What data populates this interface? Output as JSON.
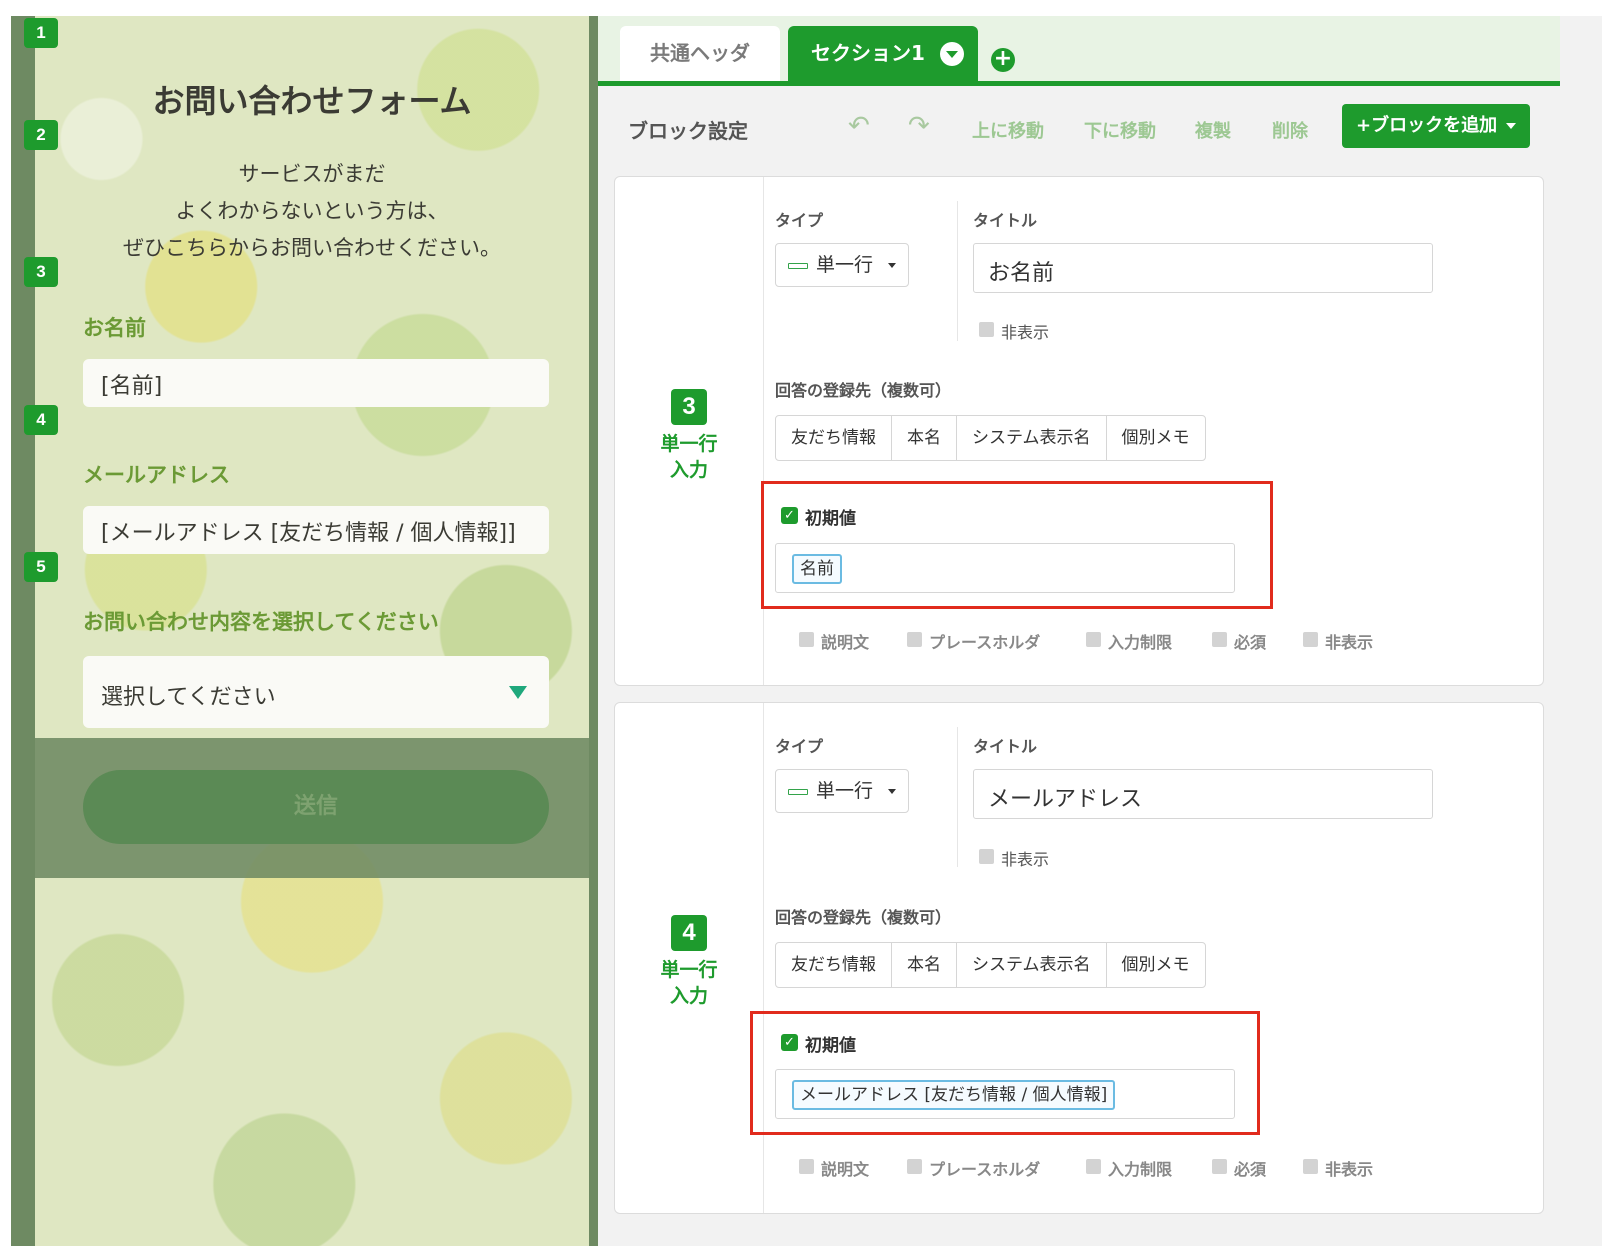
{
  "preview": {
    "badges": [
      "1",
      "2",
      "3",
      "4",
      "5"
    ],
    "title": "お問い合わせフォーム",
    "description": [
      "サービスがまだ",
      "よくわからないという方は、",
      "ぜひこちらからお問い合わせください。"
    ],
    "fields": [
      {
        "label": "お名前",
        "value": "[名前]"
      },
      {
        "label": "メールアドレス",
        "value": "[メールアドレス [友だち情報 / 個人情報]]"
      }
    ],
    "select": {
      "label": "お問い合わせ内容を選択してください",
      "value": "選択してください"
    },
    "submit_label": "送信"
  },
  "editor": {
    "tabs": {
      "common": "共通ヘッダ",
      "section": "セクション1",
      "add": "+"
    },
    "toolbar": {
      "title": "ブロック設定",
      "undo_icon": "↶",
      "redo_icon": "↷",
      "move_up": "上に移動",
      "move_down": "下に移動",
      "duplicate": "複製",
      "delete": "削除",
      "add_block": "+ブロックを追加"
    },
    "blocks": [
      {
        "number": "3",
        "type_name": [
          "単一行",
          "入力"
        ],
        "type_label": "タイプ",
        "type_value": "単一行",
        "title_label": "タイトル",
        "title_value": "お名前",
        "hide_label": "非表示",
        "dest_label": "回答の登録先（複数可）",
        "dest_options": [
          "友だち情報",
          "本名",
          "システム表示名",
          "個別メモ"
        ],
        "init_label": "初期値",
        "init_value": "名前",
        "options": [
          "説明文",
          "プレースホルダ",
          "入力制限",
          "必須",
          "非表示"
        ]
      },
      {
        "number": "4",
        "type_name": [
          "単一行",
          "入力"
        ],
        "type_label": "タイプ",
        "type_value": "単一行",
        "title_label": "タイトル",
        "title_value": "メールアドレス",
        "hide_label": "非表示",
        "dest_label": "回答の登録先（複数可）",
        "dest_options": [
          "友だち情報",
          "本名",
          "システム表示名",
          "個別メモ"
        ],
        "init_label": "初期値",
        "init_value": "メールアドレス [友だち情報 / 個人情報]",
        "options": [
          "説明文",
          "プレースホルダ",
          "入力制限",
          "必須",
          "非表示"
        ]
      }
    ]
  },
  "colors": {
    "brand_green": "#1e9b2d",
    "highlight_red": "#e12b1d"
  }
}
